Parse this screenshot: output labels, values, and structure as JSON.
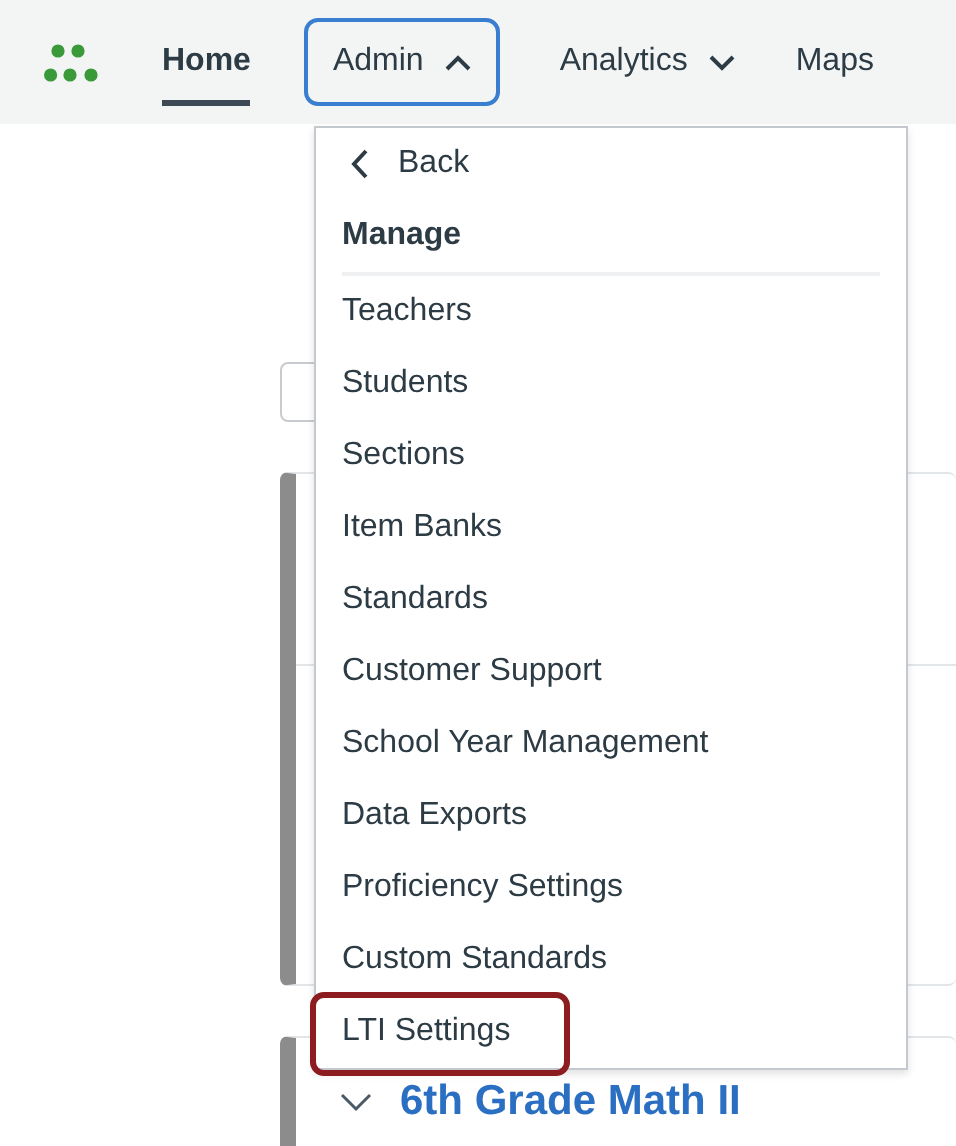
{
  "nav": {
    "items": [
      {
        "label": "Home",
        "kind": "link",
        "selected": true
      },
      {
        "label": "Admin",
        "kind": "dropdown",
        "selected": false,
        "expanded": true
      },
      {
        "label": "Analytics",
        "kind": "dropdown",
        "selected": false,
        "expanded": false
      },
      {
        "label": "Maps",
        "kind": "link",
        "selected": false
      }
    ]
  },
  "page": {
    "course_title": "6th Grade Math II"
  },
  "menu": {
    "back": "Back",
    "section": "Manage",
    "items": [
      {
        "label": "Teachers",
        "highlighted": false
      },
      {
        "label": "Students",
        "highlighted": false
      },
      {
        "label": "Sections",
        "highlighted": false
      },
      {
        "label": "Item Banks",
        "highlighted": false
      },
      {
        "label": "Standards",
        "highlighted": false
      },
      {
        "label": "Customer Support",
        "highlighted": false
      },
      {
        "label": "School Year Management",
        "highlighted": false
      },
      {
        "label": "Data Exports",
        "highlighted": false
      },
      {
        "label": "Proficiency Settings",
        "highlighted": false
      },
      {
        "label": "Custom Standards",
        "highlighted": false
      },
      {
        "label": "LTI Settings",
        "highlighted": true
      }
    ]
  }
}
